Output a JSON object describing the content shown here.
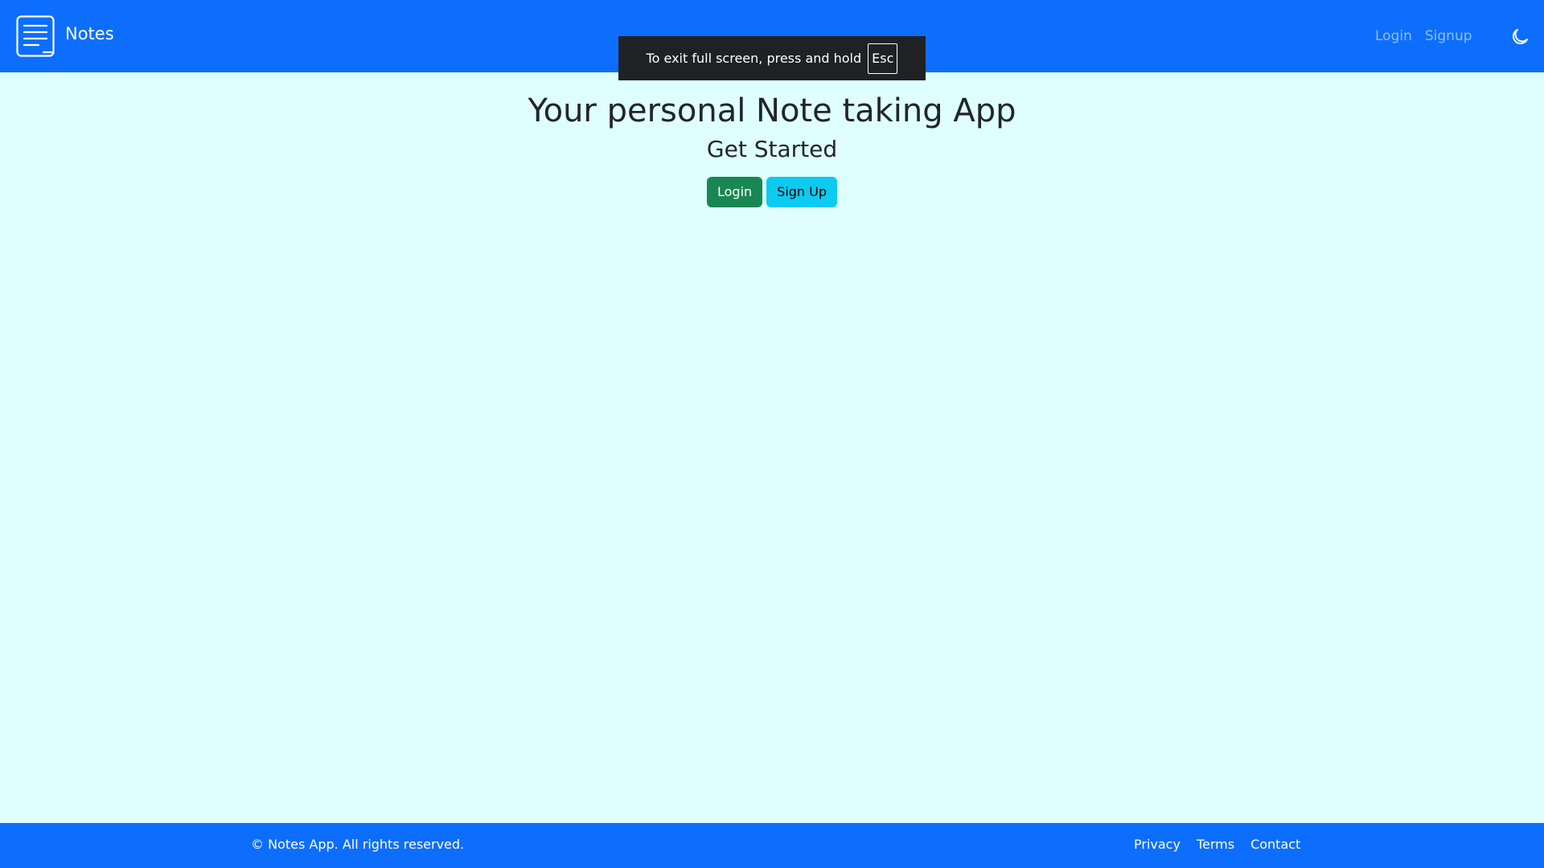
{
  "navbar": {
    "brand_text": "Notes",
    "brand_icon": "notes-app-icon",
    "links": [
      {
        "label": "Login"
      },
      {
        "label": "Signup"
      }
    ],
    "theme_toggle_icon": "moon-icon"
  },
  "fullscreen_notice": {
    "text": "To exit full screen, press and hold",
    "key": "Esc"
  },
  "hero": {
    "title": "Your personal Note taking App",
    "subtitle": "Get Started",
    "login_button": "Login",
    "signup_button": "Sign Up"
  },
  "footer": {
    "copyright": "© Notes App. All rights reserved.",
    "links": [
      {
        "label": "Privacy"
      },
      {
        "label": "Terms"
      },
      {
        "label": "Contact"
      }
    ]
  },
  "colors": {
    "primary": "#0d6efd",
    "background": "#dfffff",
    "success": "#198754",
    "info": "#0dcaf0"
  }
}
